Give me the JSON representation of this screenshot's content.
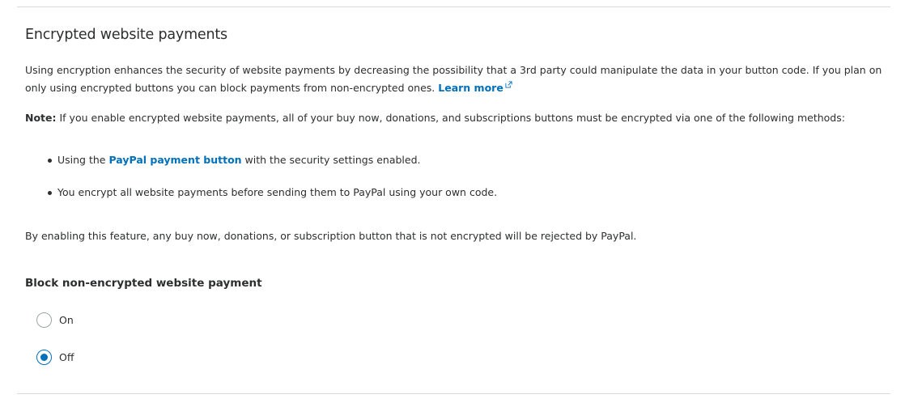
{
  "section": {
    "title": "Encrypted website payments",
    "intro": "Using encryption enhances the security of website payments by decreasing the possibility that a 3rd party could manipulate the data in your button code. If you plan on only using encrypted buttons you can block payments from non-encrypted ones.",
    "learn_more": "Learn more",
    "note_label": "Note:",
    "note_text": "If you enable encrypted website payments, all of your buy now, donations, and subscriptions buttons must be encrypted via one of the following methods:",
    "bullets": [
      {
        "prefix": "Using the",
        "link": "PayPal payment button",
        "suffix": "with the security settings enabled."
      },
      {
        "text": "You encrypt all website payments before sending them to PayPal using your own code."
      }
    ],
    "enabling_text": "By enabling this feature, any buy now, donations, or subscription button that is not encrypted will be rejected by PayPal."
  },
  "block_setting": {
    "label": "Block non-encrypted website payment",
    "options": [
      {
        "label": "On",
        "checked": false
      },
      {
        "label": "Off",
        "checked": true
      }
    ]
  },
  "colors": {
    "link": "#0070ba",
    "text": "#2c2e2f",
    "divider": "#d9d9d9"
  }
}
